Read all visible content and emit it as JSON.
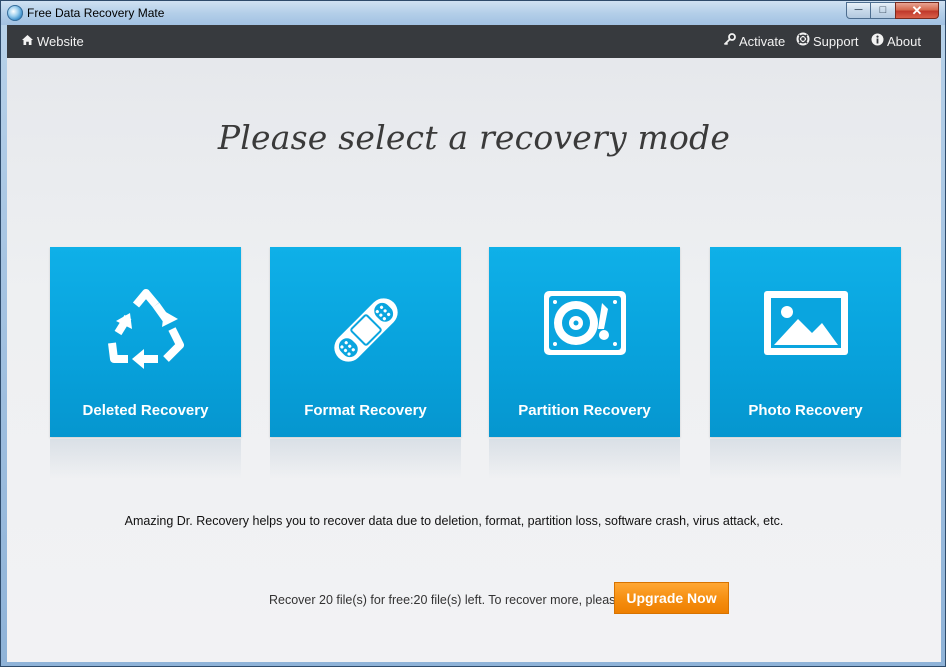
{
  "window": {
    "title": "Free Data Recovery Mate",
    "controls": {
      "minimize": "─",
      "maximize": "□",
      "close": "✕"
    }
  },
  "nav": {
    "website": {
      "label": "Website",
      "icon": "home-icon"
    },
    "activate": {
      "label": "Activate",
      "icon": "key-icon"
    },
    "support": {
      "label": "Support",
      "icon": "lifebuoy-icon"
    },
    "about": {
      "label": "About",
      "icon": "info-icon"
    }
  },
  "main": {
    "heading": "Please select a recovery mode",
    "modes": [
      {
        "label": "Deleted Recovery",
        "icon": "recycle-icon"
      },
      {
        "label": "Format Recovery",
        "icon": "bandage-icon"
      },
      {
        "label": "Partition Recovery",
        "icon": "hard-drive-icon"
      },
      {
        "label": "Photo Recovery",
        "icon": "photo-icon"
      }
    ],
    "description": "Amazing Dr. Recovery helps you to recover data due to deletion, format, partition loss, software crash, virus attack, etc."
  },
  "footer": {
    "free_text": "Recover 20 file(s) for free:20 file(s) left. To recover more, please",
    "upgrade_label": "Upgrade Now"
  },
  "colors": {
    "tile": "#0aa5df",
    "nav_bg": "#373a3e",
    "upgrade": "#f58e10"
  }
}
